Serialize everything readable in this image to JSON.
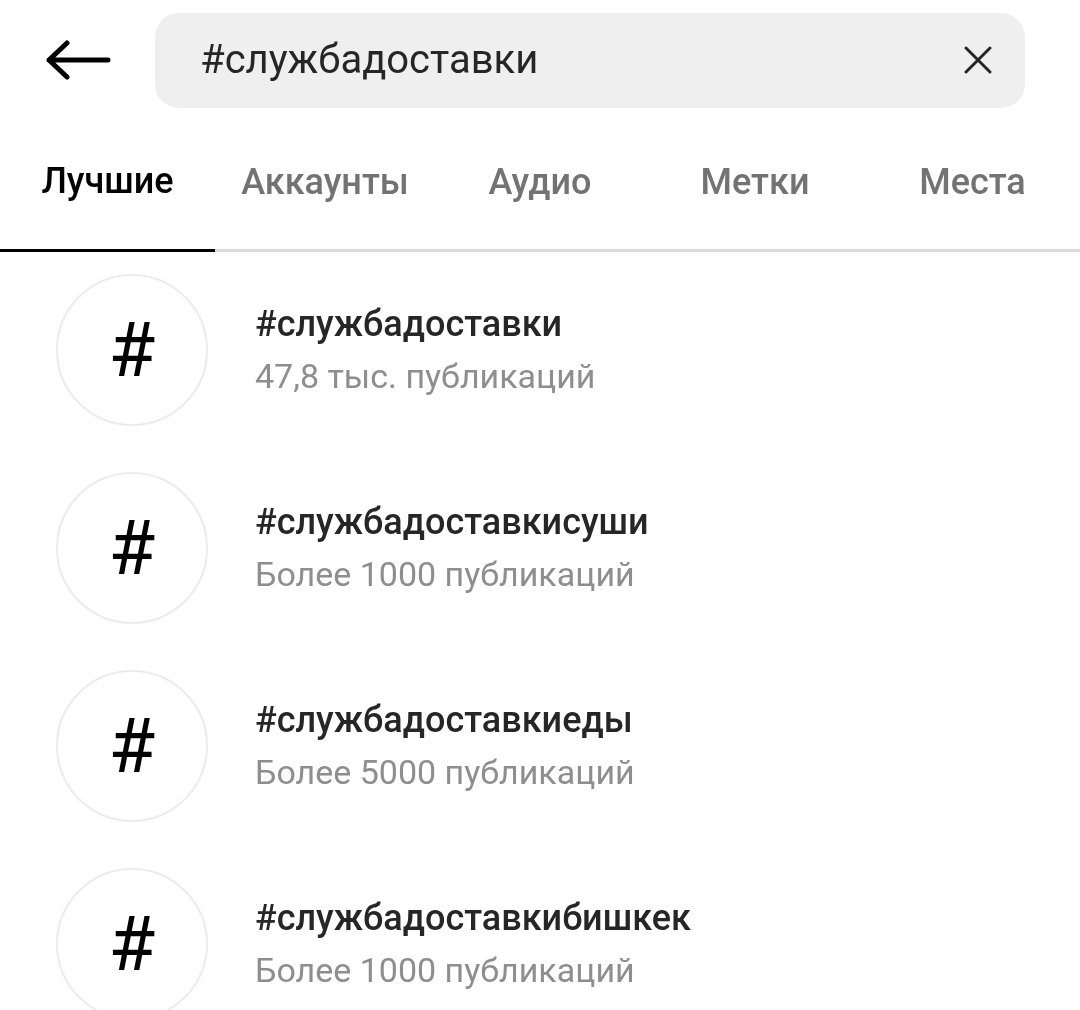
{
  "search": {
    "value": "#службадоставки"
  },
  "tabs": [
    {
      "label": "Лучшие",
      "selected": true
    },
    {
      "label": "Аккаунты",
      "selected": false
    },
    {
      "label": "Аудио",
      "selected": false
    },
    {
      "label": "Метки",
      "selected": false
    },
    {
      "label": "Места",
      "selected": false
    }
  ],
  "results": [
    {
      "icon": "#",
      "title": "#службадоставки",
      "subtitle": "47,8 тыс. публикаций"
    },
    {
      "icon": "#",
      "title": "#службадоставкисуши",
      "subtitle": "Более 1000 публикаций"
    },
    {
      "icon": "#",
      "title": "#службадоставкиеды",
      "subtitle": "Более 5000 публикаций"
    },
    {
      "icon": "#",
      "title": "#службадоставкибишкек",
      "subtitle": "Более 1000 публикаций"
    }
  ]
}
